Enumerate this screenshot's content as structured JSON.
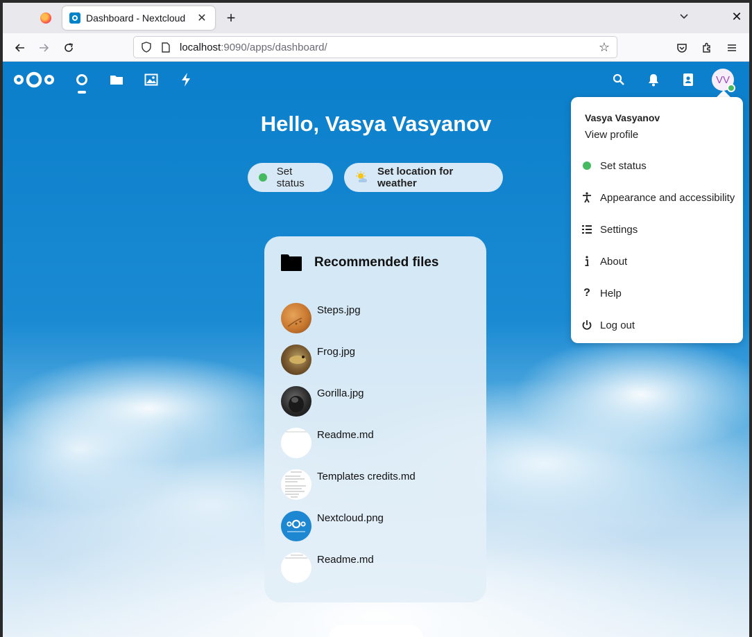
{
  "browser": {
    "tab_title": "Dashboard - Nextcloud",
    "url_host": "localhost",
    "url_rest": ":9090/apps/dashboard/"
  },
  "header": {
    "avatar_initials": "VV"
  },
  "dashboard": {
    "greeting": "Hello, Vasya Vasyanov",
    "status_button": "Set status",
    "weather_button": "Set location for weather"
  },
  "recommended": {
    "title": "Recommended files",
    "files": [
      {
        "name": "Steps.jpg"
      },
      {
        "name": "Frog.jpg"
      },
      {
        "name": "Gorilla.jpg"
      },
      {
        "name": "Readme.md"
      },
      {
        "name": "Templates credits.md"
      },
      {
        "name": "Nextcloud.png"
      },
      {
        "name": "Readme.md"
      }
    ]
  },
  "user_menu": {
    "name": "Vasya Vasyanov",
    "view_profile": "View profile",
    "items": [
      {
        "label": "Set status",
        "icon": "status-dot-icon"
      },
      {
        "label": "Appearance and accessibility",
        "icon": "accessibility-icon"
      },
      {
        "label": "Settings",
        "icon": "settings-list-icon"
      },
      {
        "label": "About",
        "icon": "info-icon"
      },
      {
        "label": "Help",
        "icon": "help-icon"
      },
      {
        "label": "Log out",
        "icon": "power-icon"
      }
    ]
  },
  "colors": {
    "brand": "#0082c9",
    "status_online": "#46ba61"
  }
}
